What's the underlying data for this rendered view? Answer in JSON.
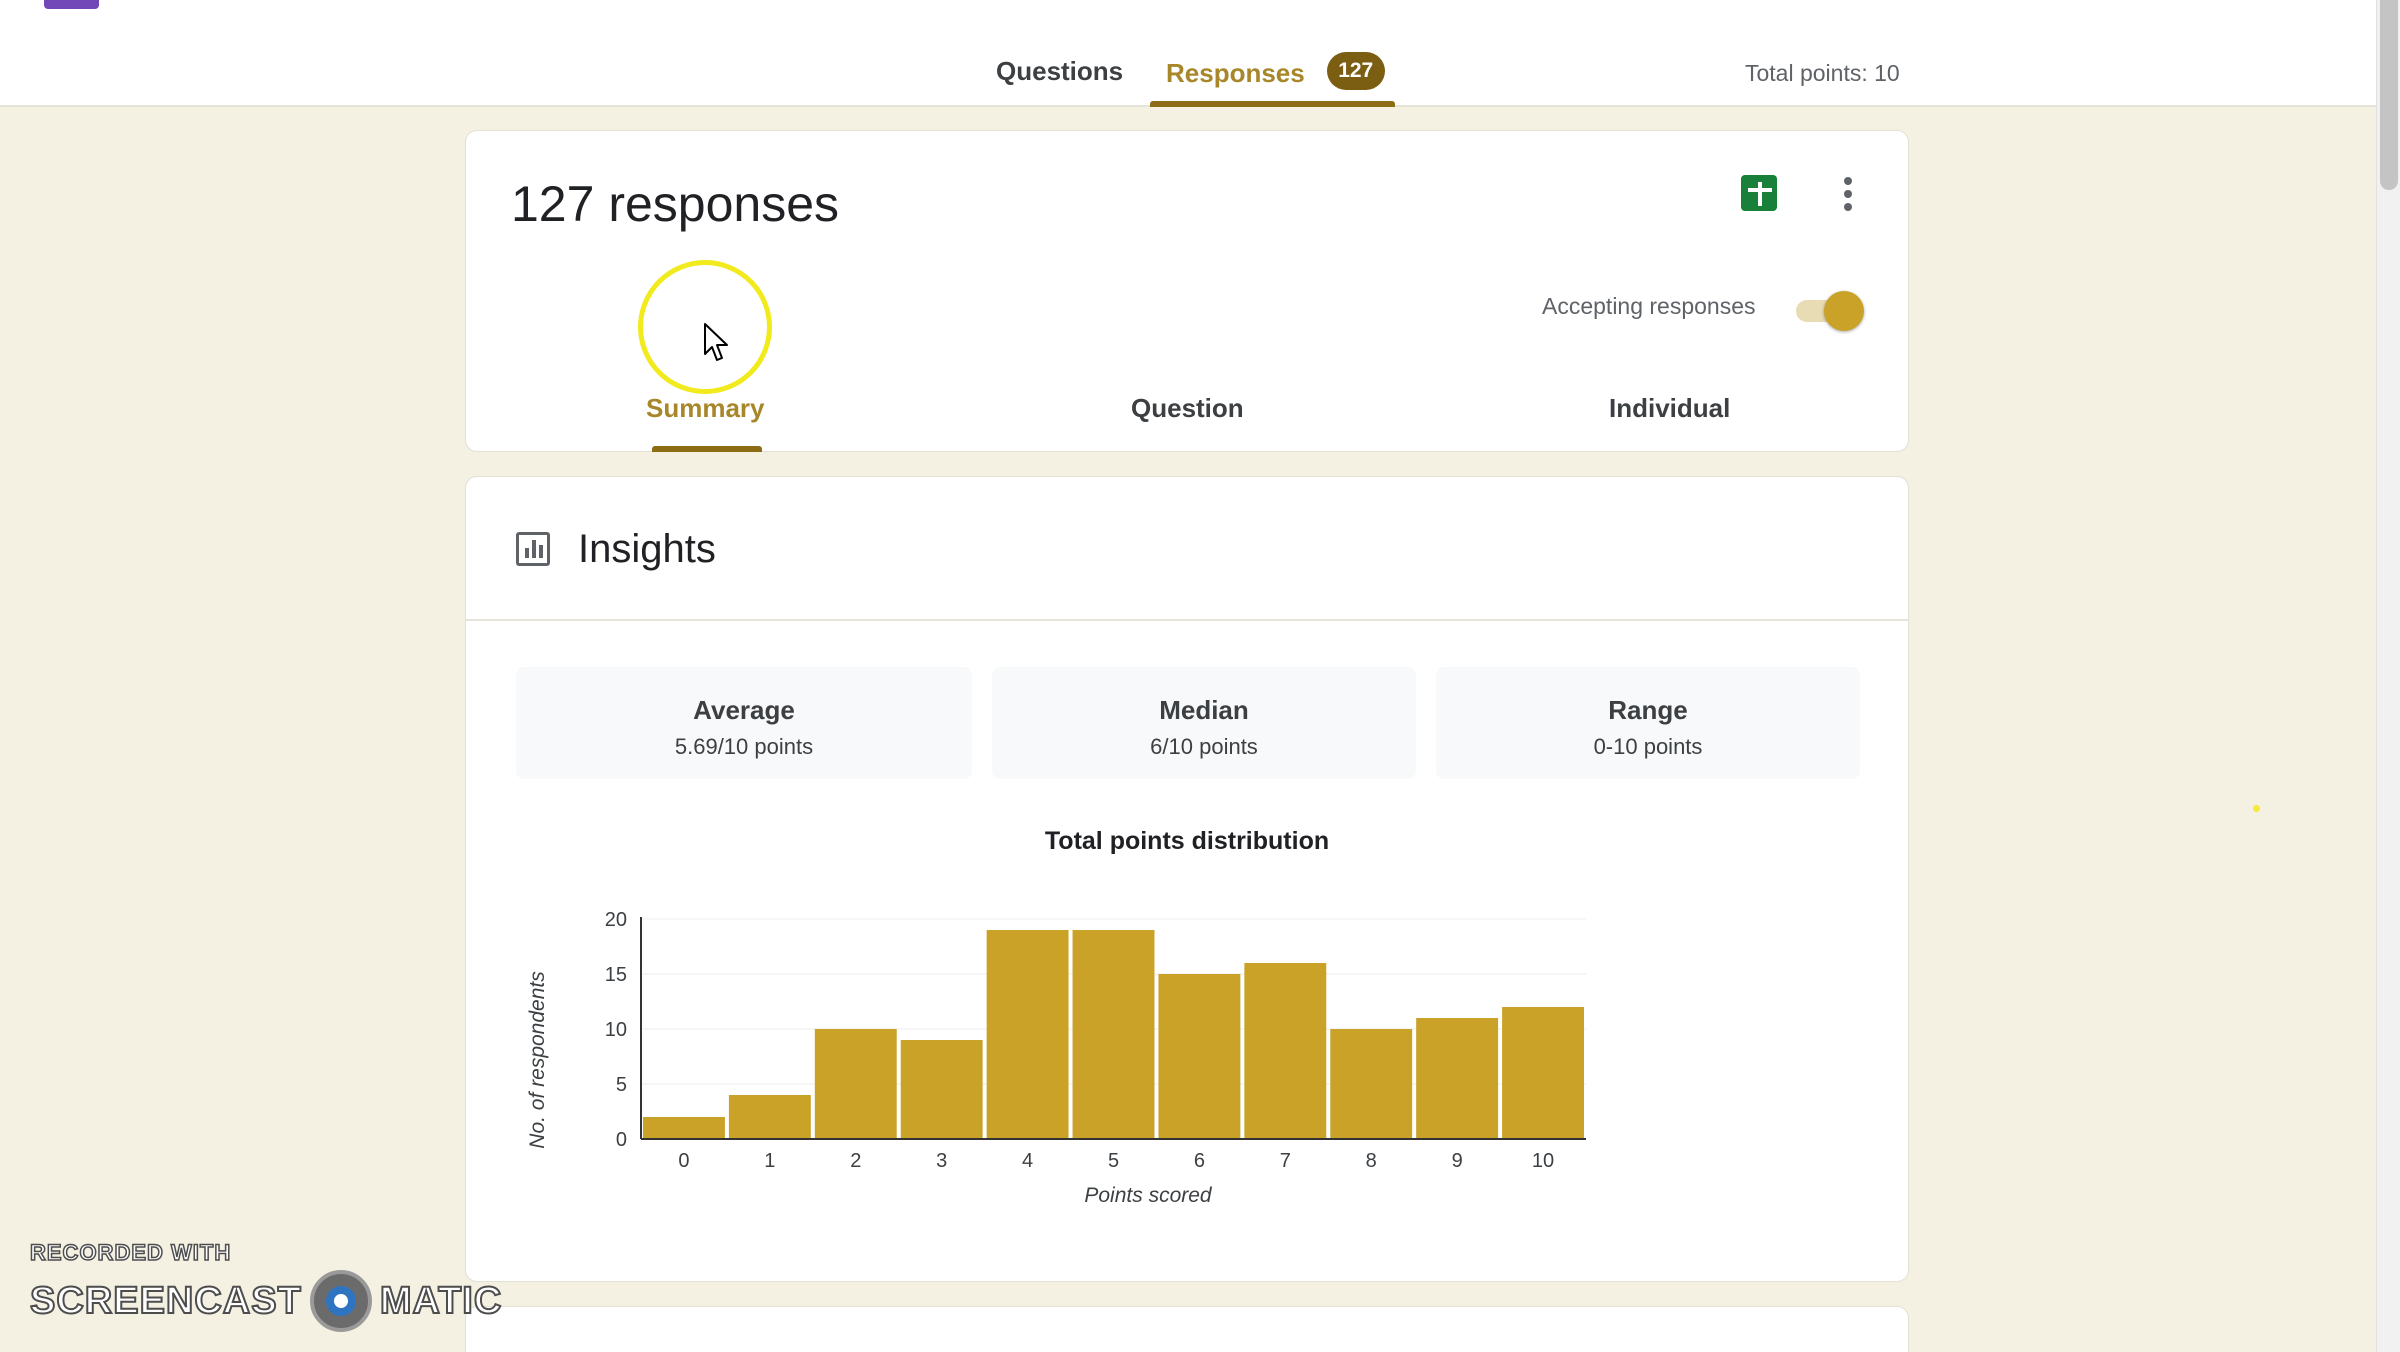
{
  "header": {
    "tabs": [
      {
        "label": "Questions"
      },
      {
        "label": "Responses",
        "badge": "127"
      }
    ],
    "total_points": "Total points: 10"
  },
  "summary_card": {
    "title": "127 responses",
    "accepting_label": "Accepting responses",
    "accepting_on": true,
    "subtabs": [
      "Summary",
      "Question",
      "Individual"
    ],
    "active_subtab": "Summary"
  },
  "insights": {
    "title": "Insights",
    "stats": [
      {
        "label": "Average",
        "value": "5.69/10 points"
      },
      {
        "label": "Median",
        "value": "6/10 points"
      },
      {
        "label": "Range",
        "value": "0-10 points"
      }
    ]
  },
  "chart_data": {
    "type": "bar",
    "title": "Total points distribution",
    "xlabel": "Points scored",
    "ylabel": "No. of respondents",
    "categories": [
      "0",
      "1",
      "2",
      "3",
      "4",
      "5",
      "6",
      "7",
      "8",
      "9",
      "10"
    ],
    "values": [
      2,
      4,
      10,
      9,
      19,
      19,
      15,
      16,
      10,
      11,
      12
    ],
    "ylim": [
      0,
      20
    ],
    "yticks": [
      0,
      5,
      10,
      15,
      20
    ],
    "bar_color": "#c9a227",
    "grid": true
  },
  "watermark": {
    "line1": "RECORDED WITH",
    "line2a": "SCREENCAST",
    "line2b": "MATIC"
  },
  "colors": {
    "accent": "#a8862a",
    "badge": "#7b5e12",
    "background": "#f5f1e2"
  }
}
